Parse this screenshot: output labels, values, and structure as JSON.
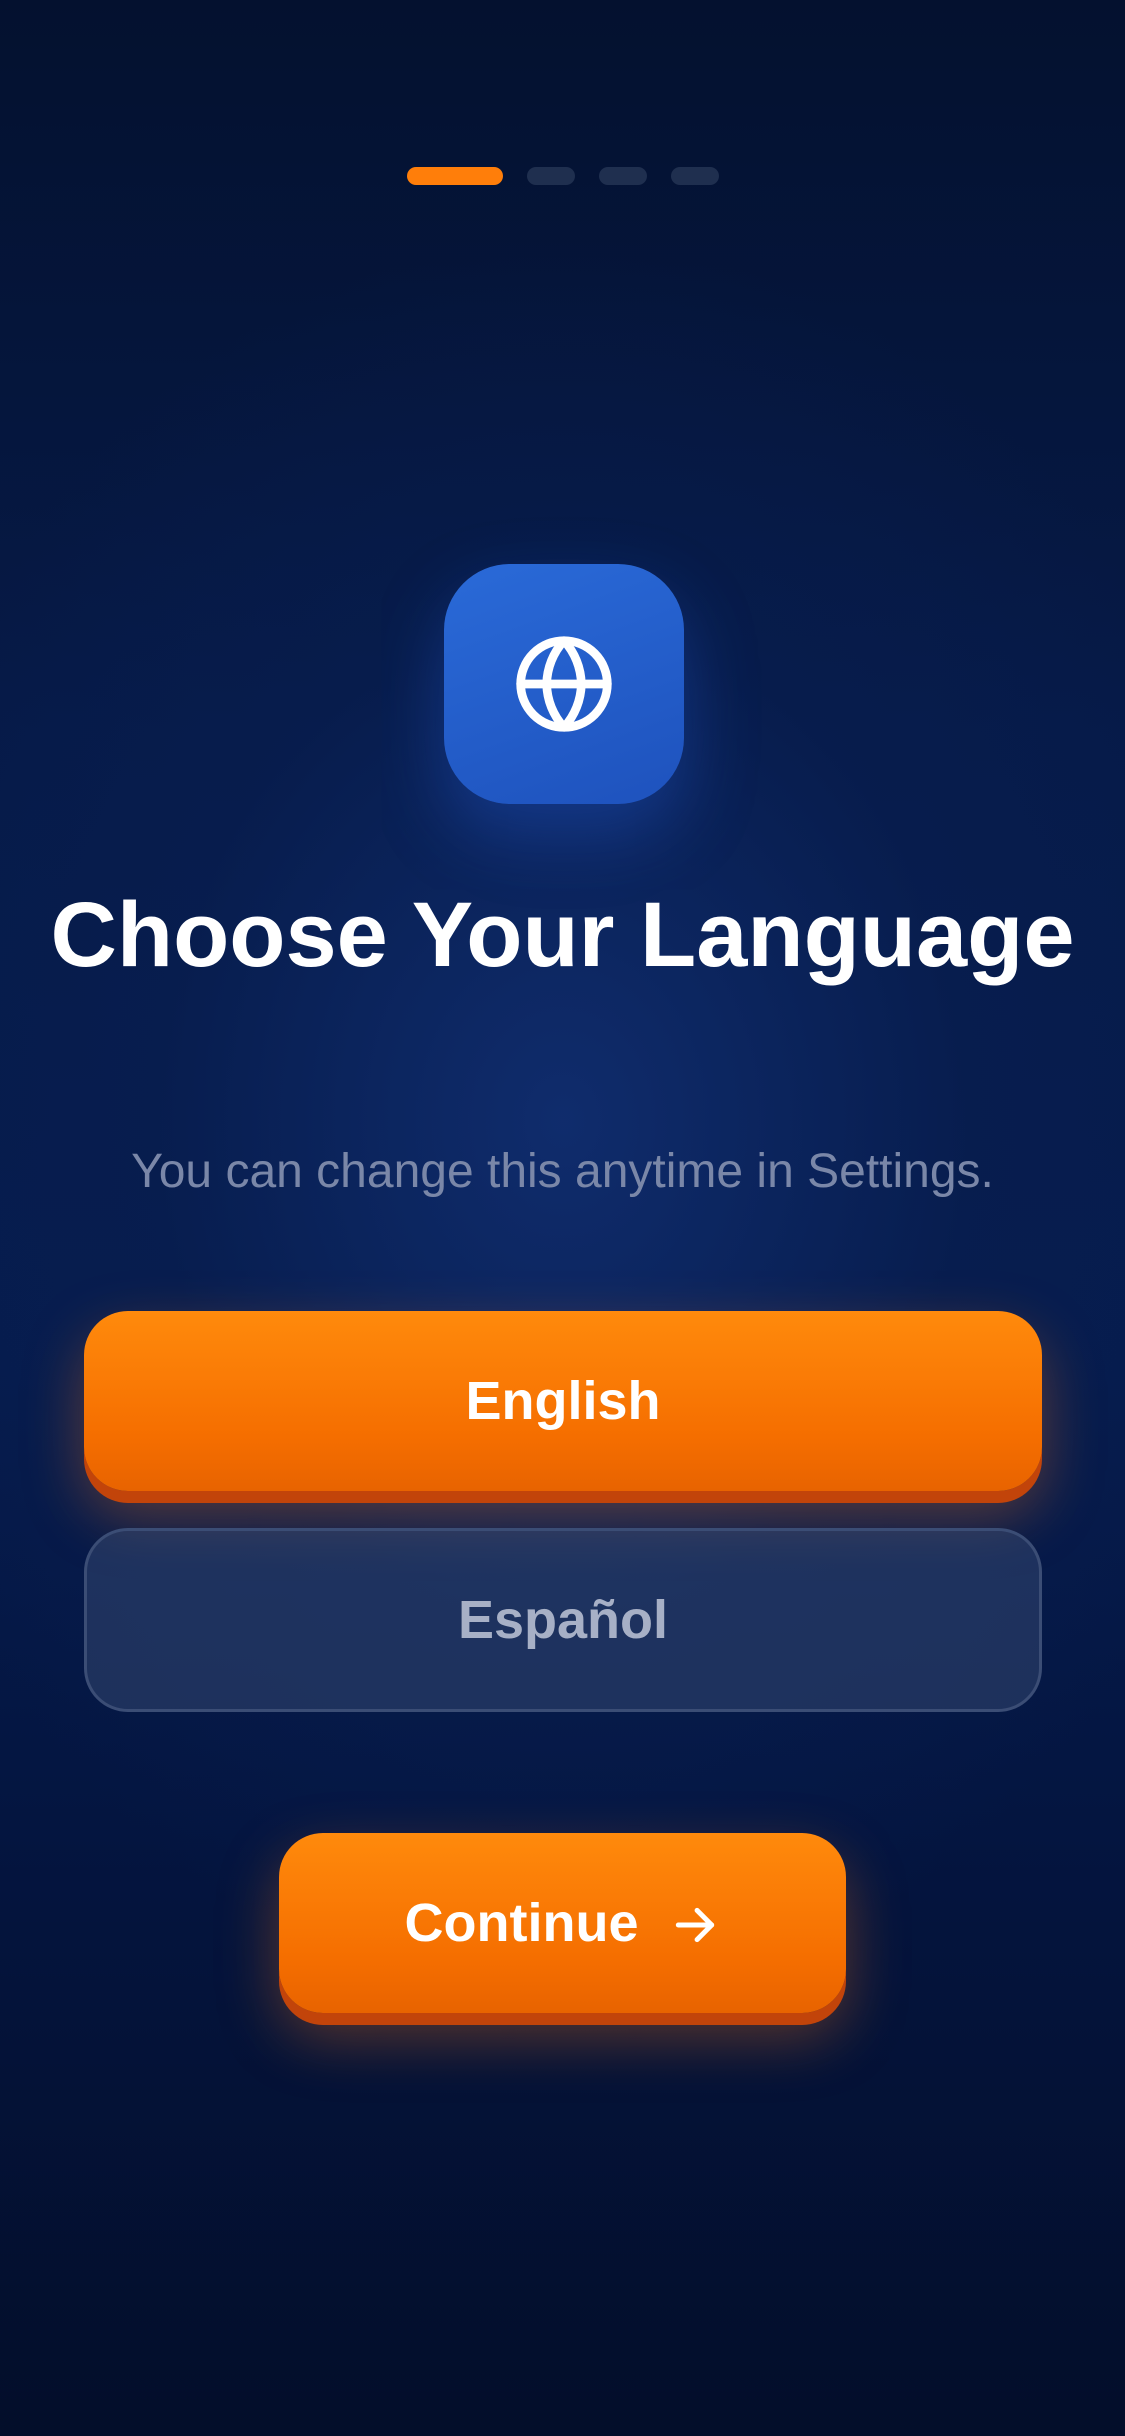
{
  "onboarding": {
    "total_steps": 4,
    "current_step": 1
  },
  "icon": {
    "name": "globe-icon"
  },
  "title": "Choose Your Language",
  "subtitle": "You can change this anytime in Settings.",
  "languages": [
    {
      "label": "English",
      "selected": true
    },
    {
      "label": "Español",
      "selected": false
    }
  ],
  "continue": {
    "label": "Continue",
    "icon": "arrow-right-icon"
  },
  "colors": {
    "accent": "#ff7e0a",
    "icon_bg": "#2463d0",
    "background": "#061a48"
  }
}
